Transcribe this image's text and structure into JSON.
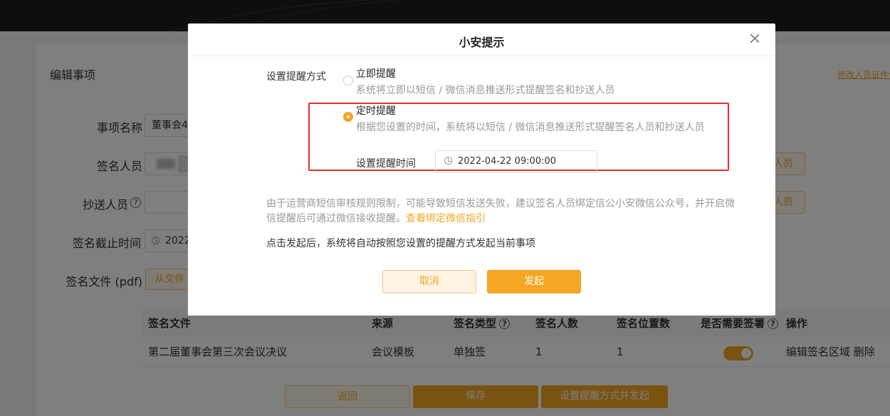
{
  "page": {
    "section_title": "编辑事项",
    "top_right_link": "修改人员证件信",
    "form": {
      "name_label": "事项名称",
      "name_value": "董事会4",
      "signers_label": "签名人员",
      "signers_add_button": "人员",
      "cc_label": "抄送人员",
      "cc_help_icon": "question-icon",
      "cc_add_button": "人员",
      "deadline_label": "签名截止时间",
      "deadline_value": "2022",
      "file_label": "签名文件 (pdf)",
      "file_button": "从文件"
    },
    "table": {
      "headers": {
        "file": "签名文件",
        "source": "来源",
        "type": "签名类型",
        "signers": "签名人数",
        "positions": "签名位置数",
        "need_stamp": "是否需要签署",
        "actions": "操作"
      },
      "rows": [
        {
          "file": "第二届董事会第三次会议决议",
          "source": "会议模板",
          "type": "单独签",
          "signers": "1",
          "positions": "1",
          "need_stamp": true,
          "actions": "编辑签名区域 删除"
        }
      ]
    },
    "buttons": {
      "back": "返回",
      "save": "保存",
      "set_and_send": "设置提醒方式并发起"
    }
  },
  "modal": {
    "title": "小安提示",
    "mode_label": "设置提醒方式",
    "options": [
      {
        "title": "立即提醒",
        "desc": "系统将立即以短信 / 微信消息推送形式提醒签名和抄送人员",
        "checked": false
      },
      {
        "title": "定时提醒",
        "desc": "根据您设置的时间，系统将以短信 / 微信消息推送形式提醒签名人员和抄送人员",
        "checked": true
      }
    ],
    "time_label": "设置提醒时间",
    "time_value": "2022-04-22 09:00:00",
    "notice_text": "由于运营商短信审核规则限制，可能导致短信发送失败，建议签名人员绑定信公小安微信公众号，并开启微信提醒后可通过微信接收提醒。",
    "notice_link": "查看绑定微信指引",
    "notice2": "点击发起后，系统将自动按照您设置的提醒方式发起当前事项",
    "cancel_label": "取消",
    "confirm_label": "发起"
  },
  "colors": {
    "accent": "#f5a623",
    "highlight": "#e5302d"
  }
}
